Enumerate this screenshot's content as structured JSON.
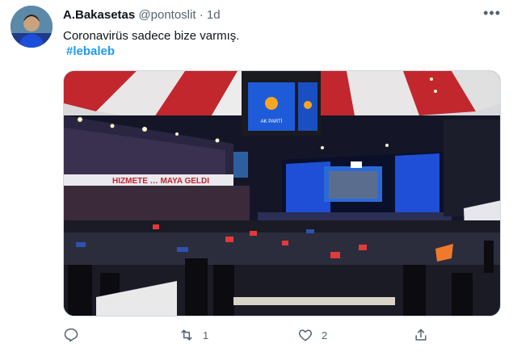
{
  "tweet": {
    "author_name": "A.Bakasetas",
    "handle": "@pontoslit",
    "separator": "·",
    "time": "1d",
    "text": "Coronavirüs sadece bize varmış.",
    "hashtag": "#lebaleb",
    "more_label": "•••"
  },
  "media": {
    "banner_text": "HIZMETE … MAYA GELDI",
    "screen_logo_text": "AK PARTİ"
  },
  "actions": {
    "reply_count": "",
    "retweet_count": "1",
    "like_count": "2"
  },
  "colors": {
    "hashtag": "#1d9bf0",
    "muted": "#536471",
    "stage_blue": "#1f4fd6"
  },
  "icons": [
    "reply-icon",
    "retweet-icon",
    "like-icon",
    "share-icon",
    "more-icon"
  ]
}
